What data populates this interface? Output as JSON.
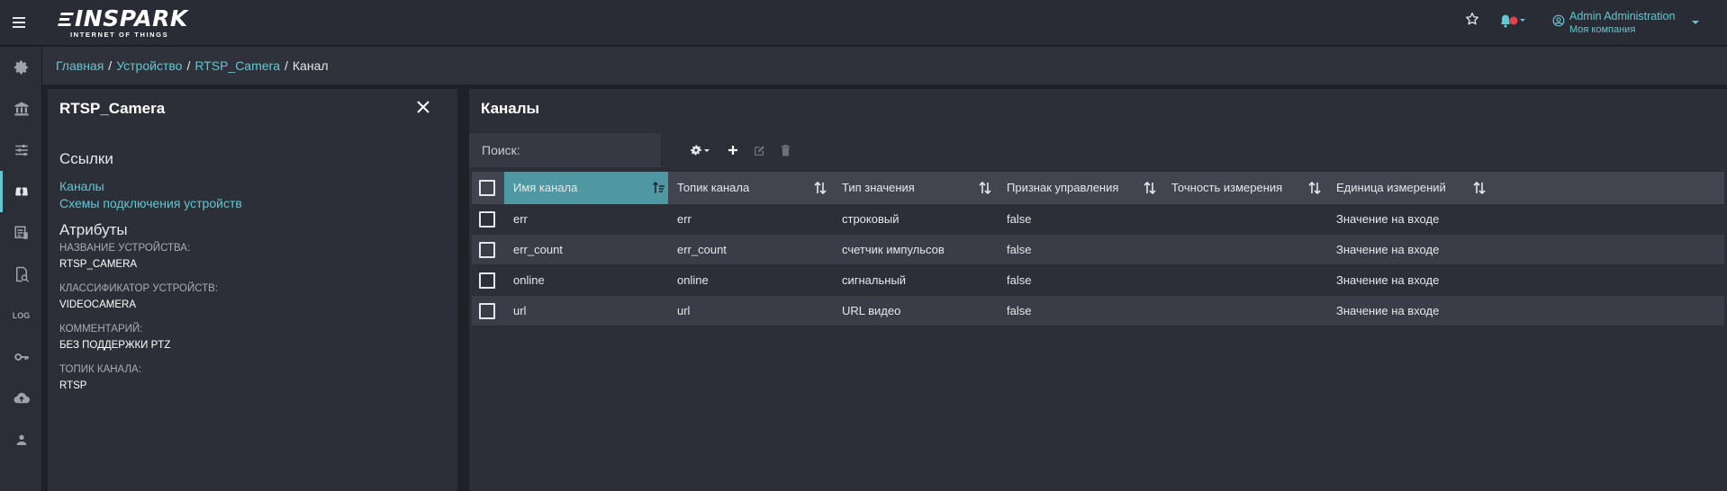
{
  "topbar": {
    "logo_text": "INSPARK",
    "logo_subtitle": "INTERNET OF THINGS",
    "user_name": "Admin  Administration",
    "user_company": "Моя компания",
    "accent_color": "#63c6d0",
    "notification_dot_color": "#e5434c",
    "icons": [
      "menu-icon",
      "star-icon",
      "bell-icon",
      "user-circle-icon",
      "chevron-down-icon"
    ]
  },
  "sidebar": {
    "items": [
      {
        "name": "gear",
        "icon": "gear-icon"
      },
      {
        "name": "bank",
        "icon": "bank-icon"
      },
      {
        "name": "sliders",
        "icon": "sliders-icon"
      },
      {
        "name": "devices",
        "icon": "devices-icon",
        "active": true
      },
      {
        "name": "reports",
        "icon": "report-icon"
      },
      {
        "name": "search-doc",
        "icon": "document-search-icon"
      },
      {
        "name": "log",
        "icon": "log-icon",
        "label": "LOG"
      },
      {
        "name": "key",
        "icon": "key-icon"
      },
      {
        "name": "upload",
        "icon": "cloud-upload-icon"
      },
      {
        "name": "user",
        "icon": "user-icon"
      }
    ]
  },
  "breadcrumb": {
    "items": [
      "Главная",
      "Устройство",
      "RTSP_Camera"
    ],
    "current": "Канал"
  },
  "left_panel": {
    "title": "RTSP_Camera",
    "links_title": "Ссылки",
    "links": [
      "Каналы",
      "Схемы подключения устройств"
    ],
    "attributes_title": "Атрибуты",
    "attributes": [
      {
        "label": "Название устройства:",
        "value": "RTSP_CAMERA"
      },
      {
        "label": "Классификатор устройств:",
        "value": "VIDEOCAMERA"
      },
      {
        "label": "Комментарий:",
        "value": "БЕЗ ПОДДЕРЖКИ PTZ"
      },
      {
        "label": "Топик канала:",
        "value": "RTSP"
      }
    ]
  },
  "right_panel": {
    "title": "Каналы",
    "search_placeholder": "Поиск:",
    "toolbar_icons": [
      "settings-dropdown-icon",
      "add-icon",
      "edit-icon",
      "delete-icon"
    ],
    "columns": [
      "Имя канала",
      "Топик канала",
      "Тип значения",
      "Признак управления",
      "Точность измерения",
      "Единица измерений"
    ],
    "sorted_column": "Имя канала",
    "rows": [
      [
        "err",
        "err",
        "строковый",
        "false",
        "",
        "Значение на входе"
      ],
      [
        "err_count",
        "err_count",
        "счетчик импульсов",
        "false",
        "",
        "Значение на входе"
      ],
      [
        "online",
        "online",
        "сигнальный",
        "false",
        "",
        "Значение на входе"
      ],
      [
        "url",
        "url",
        "URL видео",
        "false",
        "",
        "Значение на входе"
      ]
    ]
  }
}
